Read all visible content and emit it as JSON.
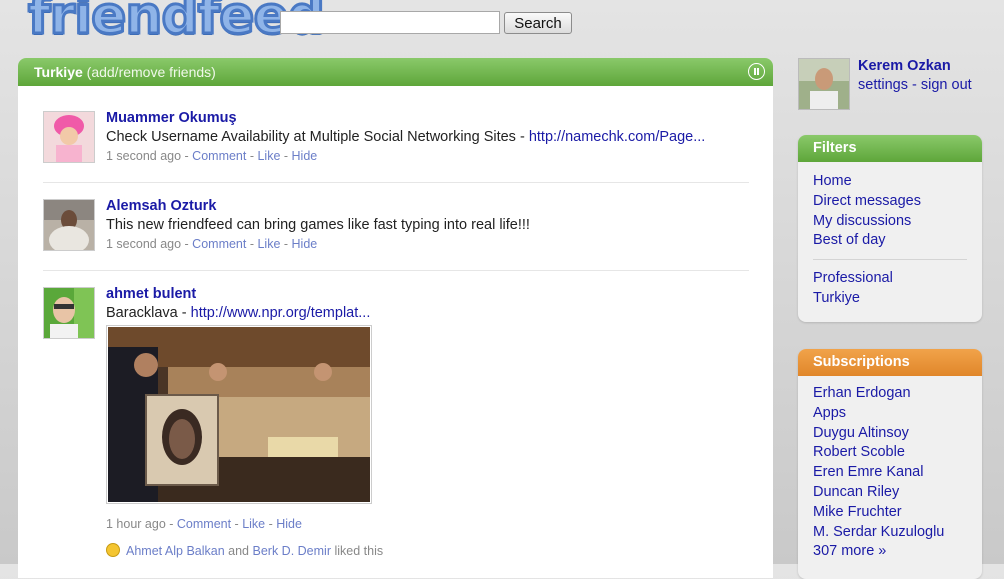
{
  "header": {
    "logo_text": "friendfeed",
    "search_value": "",
    "search_button": "Search"
  },
  "panel": {
    "title": "Turkiye",
    "subtitle": "(add/remove friends)"
  },
  "entries": [
    {
      "author": "Muammer Okumuş",
      "text": "Check Username Availability at Multiple Social Networking Sites - ",
      "link": "http://namechk.com/Page...",
      "time": "1 second ago",
      "actions": [
        "Comment",
        "Like",
        "Hide"
      ]
    },
    {
      "author": "Alemsah Ozturk",
      "text": "This new friendfeed can bring games like fast typing into real life!!!",
      "link": "",
      "time": "1 second ago",
      "actions": [
        "Comment",
        "Like",
        "Hide"
      ]
    },
    {
      "author": "ahmet bulent",
      "text": "Baracklava - ",
      "link": "http://www.npr.org/templat...",
      "time": "1 hour ago",
      "actions": [
        "Comment",
        "Like",
        "Hide"
      ],
      "liked_by": [
        "Ahmet Alp Balkan",
        "Berk D. Demir"
      ],
      "liked_and": "and",
      "liked_suffix": "liked this"
    }
  ],
  "profile": {
    "name": "Kerem Ozkan",
    "settings": "settings",
    "sign_out": "sign out"
  },
  "filters": {
    "title": "Filters",
    "items": [
      "Home",
      "Direct messages",
      "My discussions",
      "Best of day"
    ],
    "lists": [
      "Professional",
      "Turkiye"
    ]
  },
  "subscriptions": {
    "title": "Subscriptions",
    "items": [
      "Erhan Erdogan",
      "Apps",
      "Duygu Altinsoy",
      "Robert Scoble",
      "Eren Emre Kanal",
      "Duncan Riley",
      "Mike Fruchter",
      "M. Serdar Kuzuloglu"
    ],
    "more": "307 more »"
  },
  "colors": {
    "accent_green": "#6db548",
    "accent_orange": "#e8923a",
    "link_blue": "#1a1aa6"
  }
}
